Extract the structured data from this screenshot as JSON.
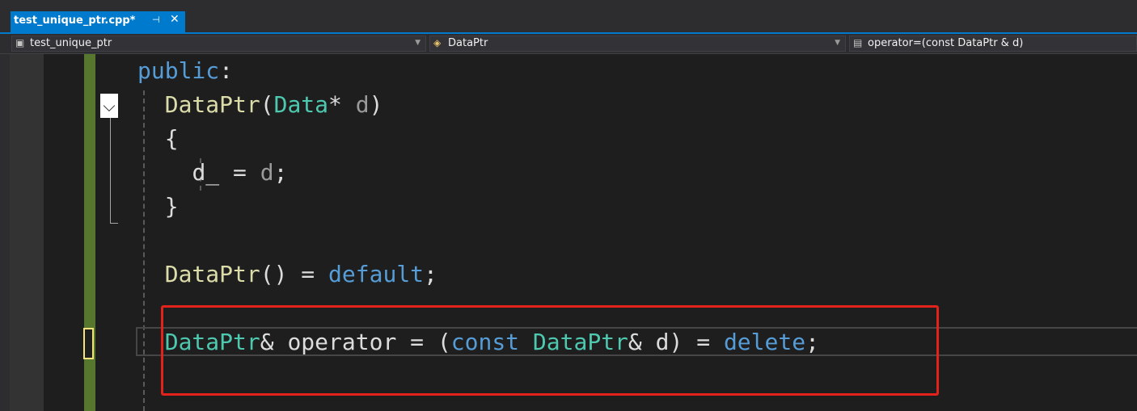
{
  "tab": {
    "title": "test_unique_ptr.cpp*",
    "pin_icon": "pin-icon",
    "close_icon": "close-icon"
  },
  "navbar": {
    "project": "test_unique_ptr",
    "class": "DataPtr",
    "member": "operator=(const DataPtr & d)"
  },
  "code": {
    "line1": {
      "kw": "public",
      "colon": ":"
    },
    "line2": {
      "fn": "DataPtr",
      "open": "(",
      "type": "Data",
      "star": "* ",
      "param": "d",
      "close": ")"
    },
    "line3": {
      "brace": "{"
    },
    "line4": {
      "lhs": "d_ = ",
      "param": "d",
      "end": ";"
    },
    "line5": {
      "brace": "}"
    },
    "line6": {
      "fn": "DataPtr",
      "mid": "() = ",
      "kw": "default",
      "end": ";"
    },
    "line7": {
      "type1": "DataPtr",
      "amp1": "& operator = (",
      "kw1": "const",
      "sp": " ",
      "type2": "DataPtr",
      "amp2": "& d) = ",
      "kw2": "delete",
      "end": ";"
    }
  },
  "colors": {
    "keyword": "#569cd6",
    "type": "#4ec9b0",
    "function": "#dcdcaa",
    "highlight_box": "#e3231b",
    "tab_accent": "#007acc",
    "change_bar": "#57772f"
  }
}
